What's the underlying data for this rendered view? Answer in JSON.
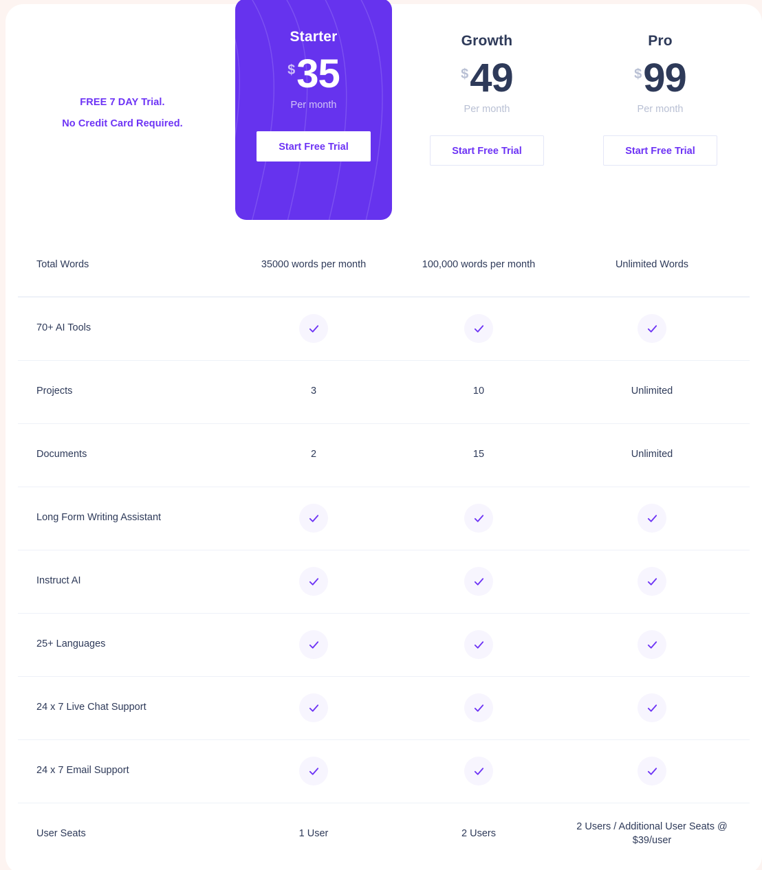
{
  "trial": {
    "line1": "FREE 7 DAY Trial.",
    "line2": "No Credit Card Required."
  },
  "colors": {
    "featured_card": "#6633EE",
    "accent_purple": "#6D33F5",
    "price_navy": "#2E3A59",
    "muted_gray": "#B9C0D4",
    "check_bg": "#F7F5FE",
    "divider": "#EEF1F8",
    "page_background": "#FDF4F1"
  },
  "plans": [
    {
      "name": "Starter",
      "currency": "$",
      "amount": "35",
      "period": "Per month",
      "cta": "Start Free Trial",
      "featured": true
    },
    {
      "name": "Growth",
      "currency": "$",
      "amount": "49",
      "period": "Per month",
      "cta": "Start Free Trial",
      "featured": false
    },
    {
      "name": "Pro",
      "currency": "$",
      "amount": "99",
      "period": "Per month",
      "cta": "Start Free Trial",
      "featured": false
    }
  ],
  "features": [
    {
      "label": "Total Words",
      "starter": "35000 words per month",
      "growth": "100,000 words per month",
      "pro": "Unlimited Words",
      "type": "text"
    },
    {
      "label": "70+ AI Tools",
      "starter": "check",
      "growth": "check",
      "pro": "check",
      "type": "check"
    },
    {
      "label": "Projects",
      "starter": "3",
      "growth": "10",
      "pro": "Unlimited",
      "type": "text"
    },
    {
      "label": "Documents",
      "starter": "2",
      "growth": "15",
      "pro": "Unlimited",
      "type": "text"
    },
    {
      "label": "Long Form Writing Assistant",
      "starter": "check",
      "growth": "check",
      "pro": "check",
      "type": "check"
    },
    {
      "label": "Instruct AI",
      "starter": "check",
      "growth": "check",
      "pro": "check",
      "type": "check"
    },
    {
      "label": "25+ Languages",
      "starter": "check",
      "growth": "check",
      "pro": "check",
      "type": "check"
    },
    {
      "label": "24 x 7 Live Chat Support",
      "starter": "check",
      "growth": "check",
      "pro": "check",
      "type": "check"
    },
    {
      "label": "24 x 7 Email Support",
      "starter": "check",
      "growth": "check",
      "pro": "check",
      "type": "check"
    },
    {
      "label": "User Seats",
      "starter": "1 User",
      "growth": "2 Users",
      "pro": "2 Users / Additional User Seats @ $39/user",
      "type": "text"
    }
  ]
}
